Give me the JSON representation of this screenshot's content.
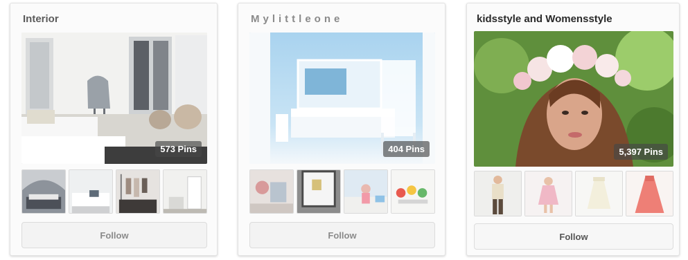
{
  "boards": [
    {
      "title": "Interior",
      "pin_count": "573 Pins",
      "follow_label": "Follow"
    },
    {
      "title": "Mylittleone",
      "pin_count": "404 Pins",
      "follow_label": "Follow"
    },
    {
      "title": "kidsstyle and Womensstyle",
      "pin_count": "5,397 Pins",
      "follow_label": "Follow"
    }
  ],
  "colors": {
    "badge_bg": "#5a5a5a",
    "follow_bg": "#f3f3f3",
    "card_border": "#e3e3e3"
  }
}
